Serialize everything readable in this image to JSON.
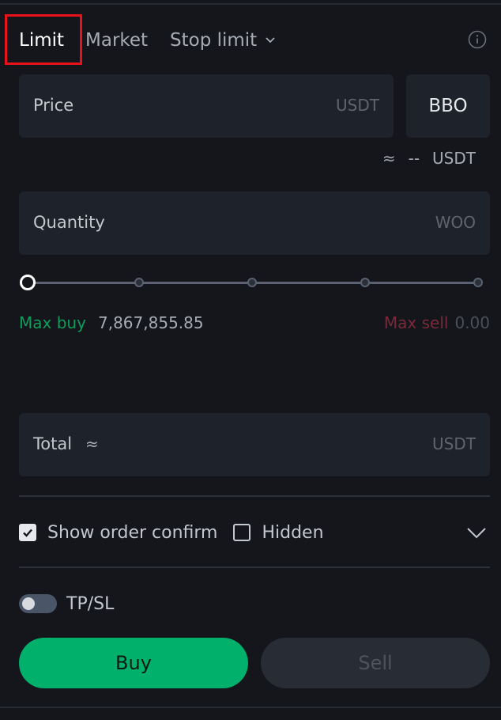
{
  "tabs": {
    "limit": "Limit",
    "market": "Market",
    "stop_limit": "Stop limit"
  },
  "price": {
    "label": "Price",
    "unit": "USDT",
    "bbo": "BBO",
    "approx_symbol": "≈",
    "approx_value": "--",
    "approx_unit": "USDT"
  },
  "quantity": {
    "label": "Quantity",
    "unit": "WOO",
    "slider_value_fraction": 0
  },
  "max": {
    "buy_label": "Max buy",
    "buy_value": "7,867,855.85",
    "sell_label": "Max sell",
    "sell_value": "0.00"
  },
  "total": {
    "label": "Total",
    "approx_symbol": "≈",
    "unit": "USDT"
  },
  "options": {
    "show_order_confirm": "Show order confirm",
    "show_order_confirm_checked": true,
    "hidden": "Hidden",
    "hidden_checked": false
  },
  "tpsl": {
    "label": "TP/SL",
    "enabled": false
  },
  "actions": {
    "buy": "Buy",
    "sell": "Sell"
  },
  "colors": {
    "background": "#14161b",
    "buy": "#00b06b",
    "max_buy": "#0f9d5b",
    "max_sell": "#7a2a3a",
    "highlight": "#e8121b"
  }
}
